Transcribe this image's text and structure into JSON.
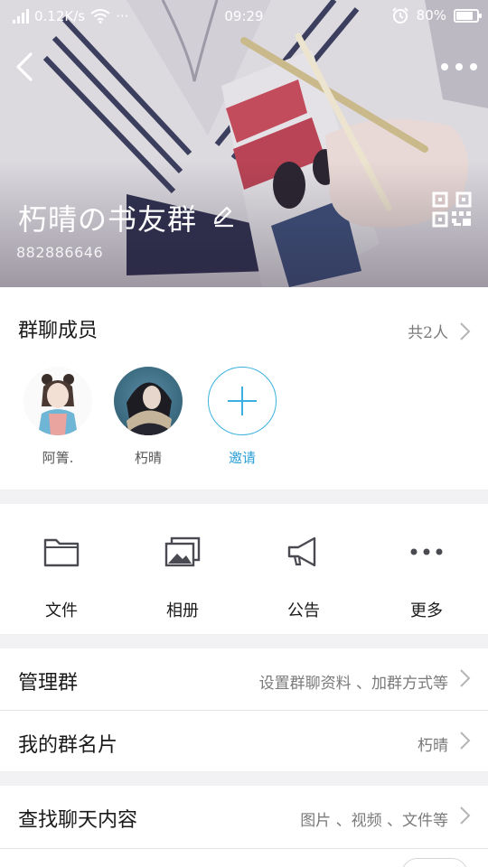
{
  "status_bar": {
    "speed": "0.12K/s",
    "dots": "···",
    "time": "09:29",
    "battery": "80%",
    "battery_level": 0.8
  },
  "header": {
    "group_name": "朽晴の书友群",
    "group_id": "882886646"
  },
  "members": {
    "title": "群聊成员",
    "count": "共2人",
    "list": [
      {
        "name": "阿箐."
      },
      {
        "name": "朽晴"
      }
    ],
    "invite_label": "邀请"
  },
  "actions": [
    {
      "label": "文件",
      "icon": "folder-icon"
    },
    {
      "label": "相册",
      "icon": "album-icon"
    },
    {
      "label": "公告",
      "icon": "megaphone-icon"
    },
    {
      "label": "更多",
      "icon": "more-dots-icon"
    }
  ],
  "settings": {
    "manage": {
      "label": "管理群",
      "hint": "设置群聊资料 、加群方式等"
    },
    "my_card": {
      "label": "我的群名片",
      "hint": "朽晴"
    },
    "search": {
      "label": "查找聊天内容",
      "hint": "图片 、视频 、文件等"
    }
  },
  "colors": {
    "accent": "#2b9fd6",
    "invite_border": "#3ab1e0",
    "page_bg": "#f2f2f4"
  }
}
